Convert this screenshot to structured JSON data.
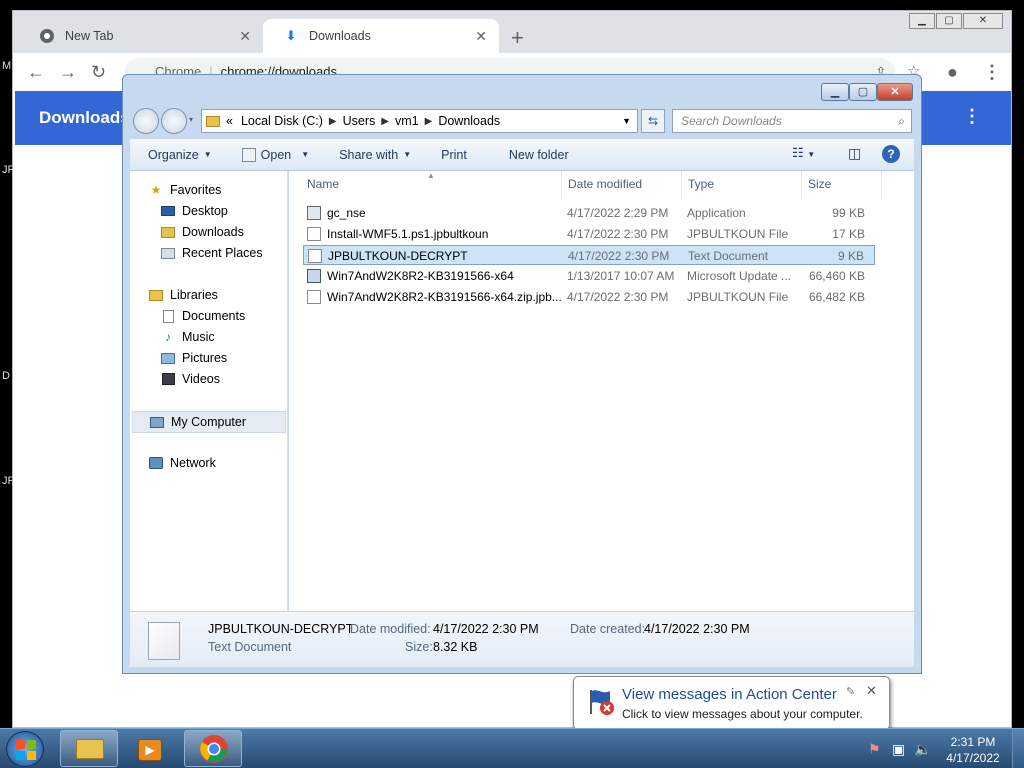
{
  "chrome": {
    "tabs": [
      {
        "title": "New Tab",
        "icon": "chrome-icon"
      },
      {
        "title": "Downloads",
        "icon": "download-icon"
      }
    ],
    "new_tab": "+",
    "omnibox": {
      "host": "Chrome",
      "separator": "|",
      "url": "chrome://downloads"
    },
    "page_title": "Downloads",
    "menu": "⋮"
  },
  "explorer": {
    "address": {
      "overflow": "«",
      "crumbs": [
        "Local Disk (C:)",
        "Users",
        "vm1",
        "Downloads"
      ]
    },
    "search_placeholder": "Search Downloads",
    "commands": [
      "Organize",
      "Open",
      "Share with",
      "Print",
      "New folder"
    ],
    "nav": {
      "favorites": "Favorites",
      "favorites_items": [
        "Desktop",
        "Downloads",
        "Recent Places"
      ],
      "libraries": "Libraries",
      "libraries_items": [
        "Documents",
        "Music",
        "Pictures",
        "Videos"
      ],
      "computer": "My Computer",
      "network": "Network"
    },
    "columns": {
      "name": "Name",
      "date": "Date modified",
      "type": "Type",
      "size": "Size"
    },
    "files": [
      {
        "name": "gc_nse",
        "date": "4/17/2022 2:29 PM",
        "type": "Application",
        "size": "99 KB"
      },
      {
        "name": "Install-WMF5.1.ps1.jpbultkoun",
        "date": "4/17/2022 2:30 PM",
        "type": "JPBULTKOUN File",
        "size": "17 KB"
      },
      {
        "name": "JPBULTKOUN-DECRYPT",
        "date": "4/17/2022 2:30 PM",
        "type": "Text Document",
        "size": "9 KB"
      },
      {
        "name": "Win7AndW2K8R2-KB3191566-x64",
        "date": "1/13/2017 10:07 AM",
        "type": "Microsoft Update ...",
        "size": "66,460 KB"
      },
      {
        "name": "Win7AndW2K8R2-KB3191566-x64.zip.jpb...",
        "date": "4/17/2022 2:30 PM",
        "type": "JPBULTKOUN File",
        "size": "66,482 KB"
      }
    ],
    "details": {
      "name": "JPBULTKOUN-DECRYPT",
      "type": "Text Document",
      "date_modified_label": "Date modified:",
      "date_modified": "4/17/2022 2:30 PM",
      "date_created_label": "Date created:",
      "date_created": "4/17/2022 2:30 PM",
      "size_label": "Size:",
      "size": "8.32 KB"
    }
  },
  "balloon": {
    "title": "View messages in Action Center",
    "text": "Click to view messages about your computer."
  },
  "taskbar": {
    "time": "2:31 PM",
    "date": "4/17/2022"
  },
  "colors": {
    "chrome_header": "#3367d6",
    "explorer_frame": "#c6d9ef",
    "selection": "#cde3f8",
    "taskbar": "#274a70"
  }
}
